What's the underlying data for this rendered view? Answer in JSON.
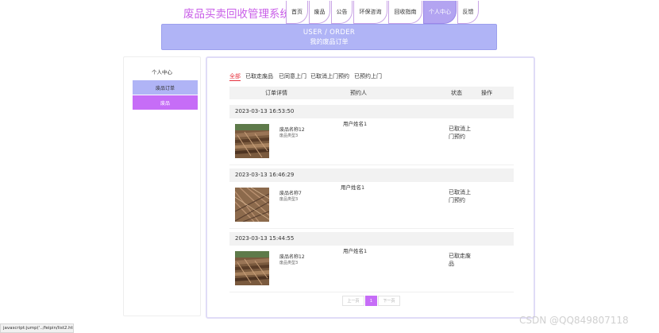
{
  "header": {
    "site_title": "废品买卖回收管理系统",
    "nav": [
      {
        "label": "首页"
      },
      {
        "label": "废品"
      },
      {
        "label": "公告"
      },
      {
        "label": "环保咨询"
      },
      {
        "label": "回收指南"
      },
      {
        "label": "个人中心",
        "active": true
      },
      {
        "label": "反馈"
      }
    ]
  },
  "banner": {
    "en": "USER / ORDER",
    "cn": "我的废品订单"
  },
  "sidebar": {
    "title": "个人中心",
    "items": [
      {
        "label": "废品订单"
      },
      {
        "label": "废品"
      }
    ]
  },
  "tabs": [
    {
      "label": "全部",
      "active": true
    },
    {
      "label": "已取走废品"
    },
    {
      "label": "已同意上门"
    },
    {
      "label": "已取消上门预约"
    },
    {
      "label": "已预约上门"
    }
  ],
  "table": {
    "headers": [
      "订单详情",
      "预约人",
      "状态",
      "操作"
    ]
  },
  "orders": [
    {
      "time": "2023-03-13 16:53:50",
      "name": "废品名称12",
      "type": "废品类型3",
      "booker": "用户姓名1",
      "status": "已取消上门预约"
    },
    {
      "time": "2023-03-13 16:46:29",
      "name": "废品名称7",
      "type": "废品类型3",
      "booker": "用户姓名1",
      "status": "已取消上门预约"
    },
    {
      "time": "2023-03-13 15:44:55",
      "name": "废品名称12",
      "type": "废品类型3",
      "booker": "用户姓名1",
      "status": "已取走废品"
    }
  ],
  "pager": {
    "prev": "上一页",
    "current": "1",
    "next": "下一页"
  },
  "statusbar": "javascript:jump('../feipin/list2.html')",
  "watermark": "CSDN @QQ849807118",
  "colors": {
    "accent_purple": "#c66df7",
    "banner_blue": "#b0b4f6",
    "title_pink": "#c95ee8",
    "active_tab_red": "#e6333f"
  },
  "icons": {
    "product_thumbnail": "scrap-wood-photo"
  }
}
